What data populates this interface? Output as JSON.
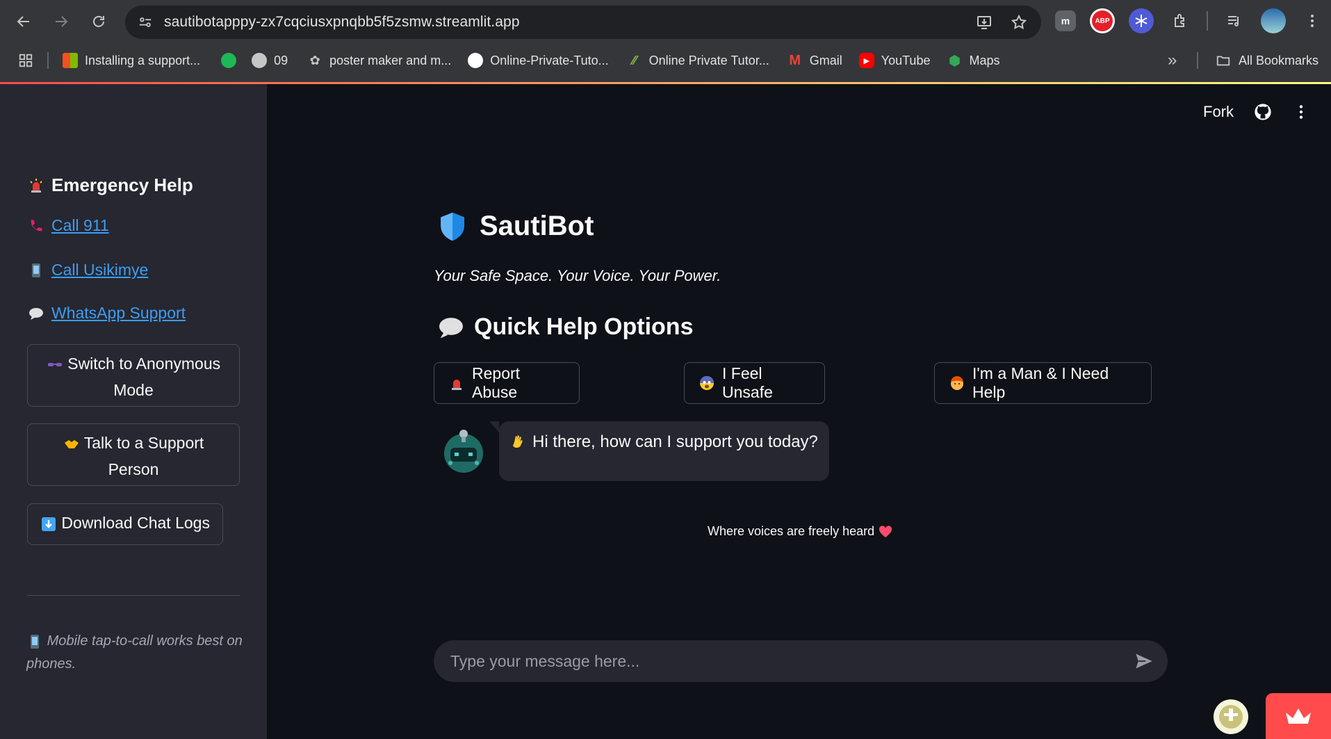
{
  "browser": {
    "url": "sautibotapppy-zx7cqciusxpnqbb5f5zsmw.streamlit.app",
    "bookmarks": [
      {
        "label": "Installing a support..."
      },
      {
        "label": ""
      },
      {
        "label": "09"
      },
      {
        "label": "poster maker and m..."
      },
      {
        "label": "Online-Private-Tuto..."
      },
      {
        "label": "Online Private Tutor..."
      },
      {
        "label": "Gmail"
      },
      {
        "label": "YouTube"
      },
      {
        "label": "Maps"
      }
    ],
    "more_label": "»",
    "all_bookmarks": "All Bookmarks",
    "extensions": {
      "m_label": "m",
      "abp_label": "ABP"
    }
  },
  "sidebar": {
    "heading": "Emergency Help",
    "links": [
      {
        "label": "Call 911"
      },
      {
        "label": "Call Usikimye"
      },
      {
        "label": "WhatsApp Support"
      }
    ],
    "buttons": [
      {
        "label": "Switch to Anonymous Mode"
      },
      {
        "label": "Talk to a Support Person"
      },
      {
        "label": "Download Chat Logs"
      }
    ],
    "note": "Mobile tap-to-call works best on phones."
  },
  "header": {
    "fork_label": "Fork"
  },
  "main": {
    "title": "SautiBot",
    "tagline": "Your Safe Space. Your Voice. Your Power.",
    "quick_help_heading": "Quick Help Options",
    "quick_buttons": [
      {
        "label": "Report Abuse"
      },
      {
        "label": "I Feel Unsafe"
      },
      {
        "label": "I'm a Man & I Need Help"
      }
    ],
    "bot_message": "Hi there, how can I support you today?",
    "footer_note": "Where voices are freely heard",
    "input_placeholder": "Type your message here..."
  },
  "colors": {
    "background": "#0e1117",
    "sidebar": "#262730",
    "link": "#3d9df3",
    "accent": "#ff4b4b",
    "text": "#fafafa"
  }
}
